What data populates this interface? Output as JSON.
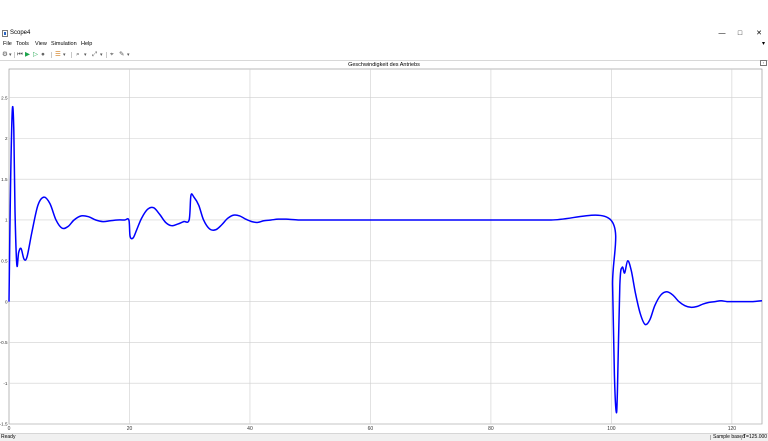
{
  "window": {
    "title": "Scope4",
    "minimize": "—",
    "maximize": "□",
    "close": "✕"
  },
  "menu": {
    "items": [
      "File",
      "Tools",
      "View",
      "Simulation",
      "Help"
    ],
    "overflow_arrow": "▾"
  },
  "toolbar": {
    "icons": [
      "gear-icon",
      "rewind-icon",
      "run-icon",
      "step-forward-icon",
      "stop-icon",
      "highlight-icon",
      "zoom-icon",
      "fit-view-icon",
      "cursor-measure-icon",
      "style-icon"
    ],
    "glyphs": {
      "gear": "⚙",
      "rewind": "⏮",
      "run": "▶",
      "step": "▷",
      "stop": "●",
      "highlight": "☰",
      "zoom": "⌕",
      "fit": "⤢",
      "cursor": "⌖",
      "style": "✎",
      "dropdown": "▾"
    }
  },
  "status": {
    "left": "Ready",
    "mode": "Sample based",
    "time": "T=125.000"
  },
  "chart_data": {
    "type": "line",
    "title": "Geschwindigkeit des Antriebs",
    "xlabel": "",
    "ylabel": "",
    "xlim": [
      0,
      125
    ],
    "ylim": [
      -1.5,
      2.85
    ],
    "xticks": [
      0,
      20,
      40,
      60,
      80,
      100,
      120
    ],
    "yticks": [
      -1.5,
      -1,
      -0.5,
      0,
      0.5,
      1,
      1.5,
      2,
      2.5
    ],
    "ytick_labels": [
      "-1.5",
      "-1",
      "-0.5",
      "0",
      "0.5",
      "1",
      "1.5",
      "2",
      "2.5"
    ],
    "grid": true,
    "line_color": "#0000ff",
    "series": [
      {
        "x": [
          0,
          0.25,
          0.55,
          0.8,
          1.0,
          1.3,
          1.6,
          2.0,
          2.5,
          3.0,
          3.8,
          4.8,
          5.8,
          6.8,
          7.8,
          8.8,
          9.8,
          10.8,
          12,
          13.2,
          14.4,
          15.6,
          16.8,
          18,
          19.2,
          19.9,
          20.1,
          20.6,
          21.2,
          22,
          23,
          24,
          25,
          26,
          27,
          28,
          29,
          29.9,
          30.2,
          30.7,
          31.5,
          32.3,
          33.3,
          34.3,
          35.3,
          36.3,
          37.3,
          38.3,
          39.3,
          40.3,
          41.3,
          42.3,
          43.5,
          44.7,
          46,
          48,
          50,
          52,
          54,
          56,
          58,
          60,
          70,
          80,
          90,
          99.9,
          100.2,
          100.5,
          100.8,
          101.0,
          101.4,
          101.8,
          102.2,
          102.7,
          103.3,
          104,
          104.8,
          105.6,
          106.4,
          107.2,
          108.2,
          109.2,
          110.2,
          111.2,
          112.2,
          113.2,
          114.2,
          115.2,
          116.2,
          117.2,
          118.2,
          119.2,
          120.2,
          121.2,
          122.5,
          123.5,
          125
        ],
        "y": [
          0,
          1.4,
          2.35,
          2.1,
          1.1,
          0.45,
          0.6,
          0.65,
          0.52,
          0.55,
          0.85,
          1.18,
          1.28,
          1.2,
          1.0,
          0.9,
          0.92,
          1.0,
          1.05,
          1.04,
          1.0,
          0.98,
          0.99,
          1.0,
          1.0,
          1.0,
          0.8,
          0.78,
          0.88,
          1.02,
          1.13,
          1.15,
          1.07,
          0.97,
          0.93,
          0.95,
          0.98,
          1.0,
          1.3,
          1.28,
          1.18,
          1.0,
          0.89,
          0.88,
          0.94,
          1.02,
          1.06,
          1.05,
          1.01,
          0.98,
          0.97,
          0.99,
          1.0,
          1.01,
          1.01,
          1.0,
          1.0,
          1.0,
          1.0,
          1.0,
          1.0,
          1.0,
          1.0,
          1.0,
          1.0,
          1.0,
          0.2,
          -0.9,
          -1.35,
          -1.1,
          0.2,
          0.42,
          0.35,
          0.5,
          0.38,
          0.1,
          -0.15,
          -0.28,
          -0.22,
          -0.05,
          0.08,
          0.12,
          0.08,
          0.0,
          -0.05,
          -0.07,
          -0.06,
          -0.03,
          -0.01,
          0.0,
          0.01,
          0.0,
          0.0,
          0.0,
          0.0,
          0.0,
          0.01
        ]
      }
    ]
  }
}
